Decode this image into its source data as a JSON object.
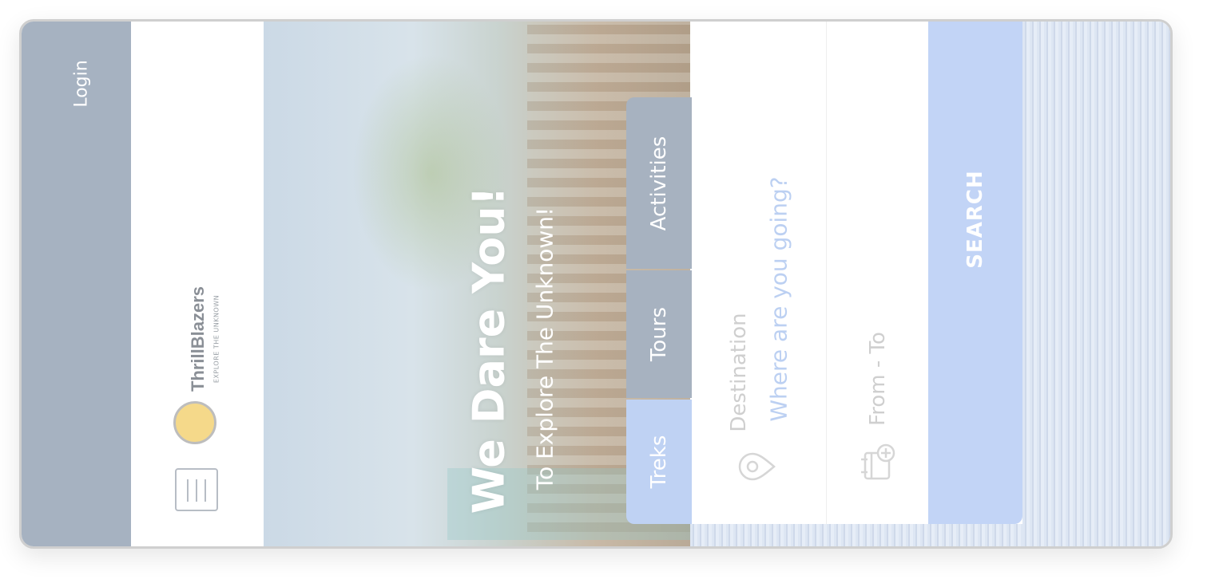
{
  "header": {
    "login_label": "Login",
    "menu_icon": "hamburger-menu-icon"
  },
  "logo": {
    "brand": "ThrillBlazers",
    "registered": "®",
    "tagline": "EXPLORE THE UNKNOWN"
  },
  "hero": {
    "title": "We Dare You!",
    "subtitle": "To Explore The Unknown!"
  },
  "tabs": [
    {
      "label": "Activities",
      "active": false
    },
    {
      "label": "Tours",
      "active": false
    },
    {
      "label": "Treks",
      "active": true
    }
  ],
  "search": {
    "destination_label": "Destination",
    "destination_placeholder": "Where are you going?",
    "date_label": "From - To",
    "button_label": "SEARCH",
    "icons": {
      "destination": "map-pin-icon",
      "date": "calendar-add-icon"
    }
  },
  "colors": {
    "login_bar": "#a6b2c1",
    "tab_inactive": "#a7b2c0",
    "tab_active": "#bfd2f3",
    "search_button": "#c2d4f6",
    "placeholder": "#bcd0f2"
  }
}
